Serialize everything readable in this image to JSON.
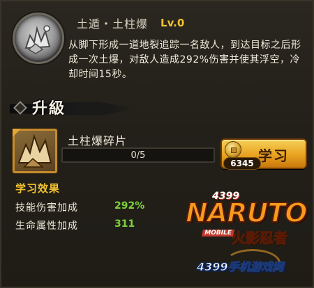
{
  "skill": {
    "name": "土遁・土柱爆",
    "level": "Lv.0",
    "description": "从脚下形成一道地裂追踪一名敌人，到达目标之后形成一次土爆，对敌人造成292%伤害并使其浮空，冷却时间15秒。",
    "icon": "earth-burst-skill-icon"
  },
  "upgrade": {
    "label": "升級",
    "fragment": {
      "name": "土柱爆碎片",
      "progress_text": "0/5",
      "progress_fraction": 0,
      "icon": "fragment-icon"
    },
    "learn_button": {
      "label": "学习",
      "cost": "6345",
      "cost_icon": "coin-icon"
    }
  },
  "effect": {
    "title": "学习效果",
    "stats": [
      {
        "label": "技能伤害加成",
        "value": "292%"
      },
      {
        "label": "生命属性加成",
        "value": "311"
      }
    ]
  },
  "watermark": {
    "brand_top": "4399",
    "logo": "NARUTO",
    "mobile": "MOBILE",
    "cn_title": "火影忍者",
    "site": "4399手机游戏网"
  },
  "colors": {
    "accent_gold": "#f1c232",
    "stat_green": "#7ed23a",
    "button_orange": "#e9a21f"
  }
}
